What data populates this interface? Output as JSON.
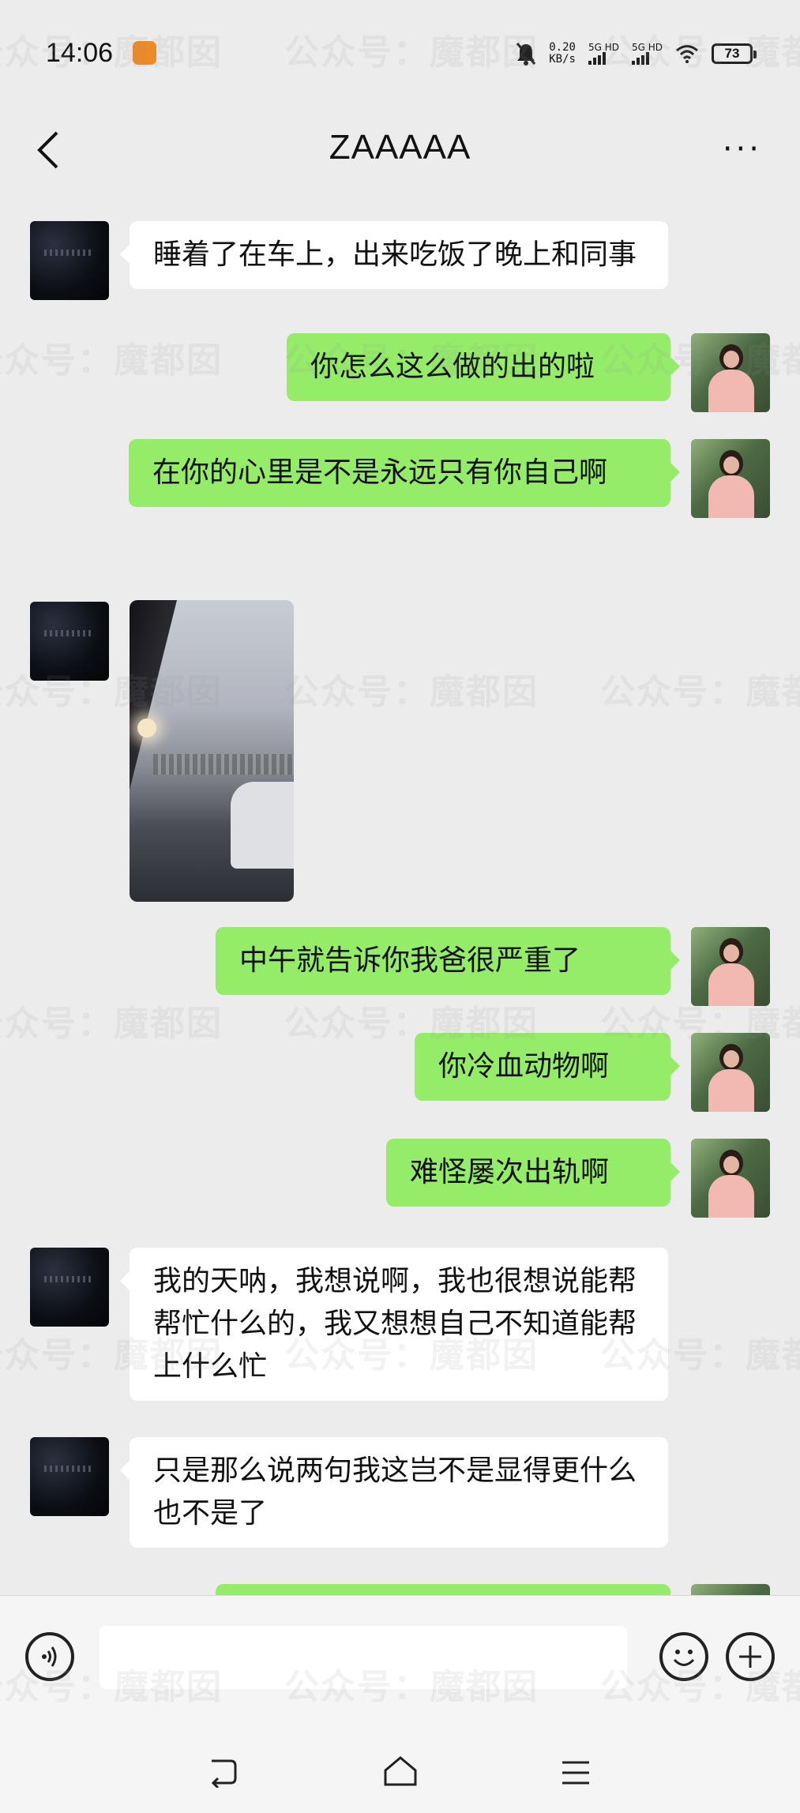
{
  "status_bar": {
    "time": "14:06",
    "net_speed_value": "0.20",
    "net_speed_unit": "KB/s",
    "sim1_label": "5G HD",
    "sim2_label": "5G HD",
    "battery": "73"
  },
  "header": {
    "title": "ZAAAAA"
  },
  "messages": [
    {
      "side": "in",
      "type": "text",
      "text": "睡着了在车上，出来吃饭了晚上和同事"
    },
    {
      "side": "out",
      "type": "text",
      "text": "你怎么这么做的出的啦"
    },
    {
      "side": "out",
      "type": "text",
      "text": "在你的心里是不是永远只有你自己啊"
    },
    {
      "side": "in",
      "type": "image",
      "text": ""
    },
    {
      "side": "out",
      "type": "text",
      "text": "中午就告诉你我爸很严重了"
    },
    {
      "side": "out",
      "type": "text",
      "text": "你冷血动物啊"
    },
    {
      "side": "out",
      "type": "text",
      "text": "难怪屡次出轨啊"
    },
    {
      "side": "in",
      "type": "text",
      "text": "我的天呐，我想说啊，我也很想说能帮帮忙什么的，我又想想自己不知道能帮上什么忙"
    },
    {
      "side": "in",
      "type": "text",
      "text": "只是那么说两句我这岂不是显得更什么也不是了"
    }
  ],
  "watermark": {
    "text": "公众号：魔都囡"
  },
  "colors": {
    "background": "#ececec",
    "outgoing_bubble": "#95ec69",
    "incoming_bubble": "#ffffff"
  },
  "icons": {
    "back": "back-icon",
    "more": "more-icon",
    "voice": "voice-icon",
    "emoji": "emoji-icon",
    "add": "plus-icon"
  }
}
